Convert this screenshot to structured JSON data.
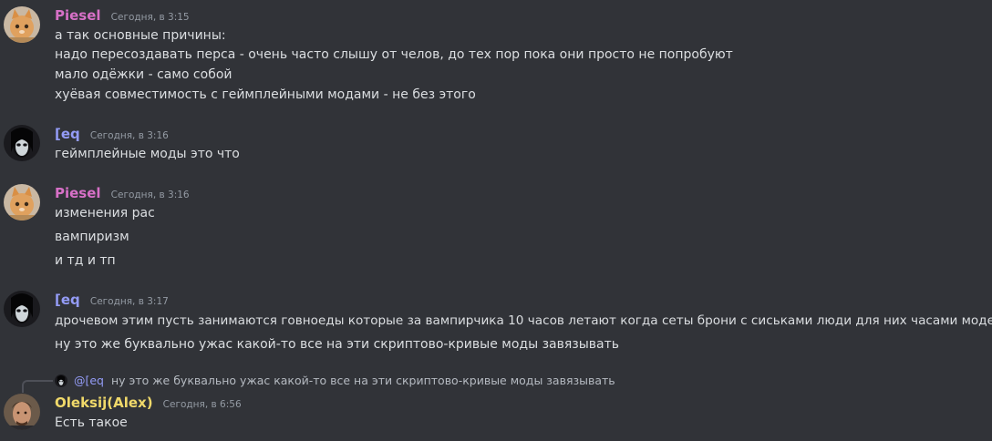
{
  "messages": [
    {
      "author": "Piesel",
      "author_color": "#d770c7",
      "avatar": "cat-avatar",
      "time": "Сегодня, в 3:15",
      "lines": [
        "а так основные причины:",
        "надо пересоздавать перса - очень часто слышу от челов, до тех пор пока они просто не попробуют",
        "мало одёжки - само собой",
        "хуёвая совместимость с геймплейными модами - не без этого"
      ]
    },
    {
      "author": "[eq",
      "author_color": "#949cf7",
      "avatar": "dark-figure-avatar",
      "time": "Сегодня, в 3:16",
      "lines": [
        "геймплейные моды это что"
      ]
    },
    {
      "author": "Piesel",
      "author_color": "#d770c7",
      "avatar": "cat-avatar",
      "time": "Сегодня, в 3:16",
      "lines": [
        "изменения рас",
        "вампиризм",
        "и тд и тп"
      ]
    },
    {
      "author": "[eq",
      "author_color": "#949cf7",
      "avatar": "dark-figure-avatar",
      "time": "Сегодня, в 3:17",
      "lines": [
        "дрочевом этим пусть занимаются говноеды которые за вампирчика 10 часов летают когда сеты брони с сиськами люди для них часами моделят",
        "ну это же буквально ужас какой-то все на эти скриптово-кривые моды завязывать"
      ]
    },
    {
      "author": "Oleksij(Alex)",
      "author_color": "#f0d96a",
      "avatar": "man-portrait-avatar",
      "time": "Сегодня, в 6:56",
      "reply": {
        "mention": "@[eq",
        "text": "ну это же буквально ужас какой-то все на эти скриптово-кривые моды завязывать"
      },
      "lines": [
        "Есть такое"
      ]
    }
  ]
}
